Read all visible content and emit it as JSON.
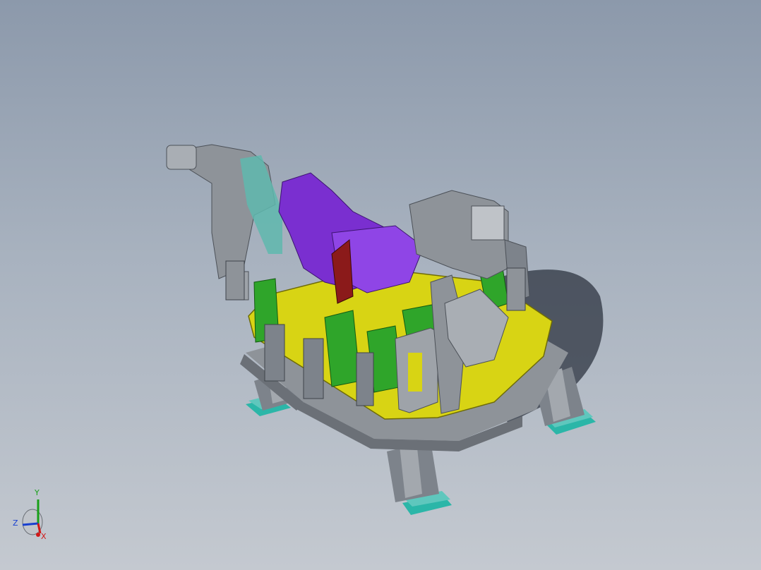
{
  "viewport": {
    "background_top": "#8c99ab",
    "background_bottom": "#c4c9d0"
  },
  "model": {
    "colors": {
      "base_plate": "#d8d414",
      "frame_gray": "#8e9399",
      "frame_dark": "#5e636a",
      "purple": "#7a2fd0",
      "green": "#2fa52a",
      "red": "#8b1a1a",
      "teal": "#2bb6a8",
      "cyan_panel": "#5fb8ae",
      "shadow": "#2e3440"
    }
  },
  "triad": {
    "x_label": "X",
    "y_label": "Y",
    "z_label": "Z",
    "x_color": "#d01818",
    "y_color": "#18a018",
    "z_color": "#1840d0"
  }
}
